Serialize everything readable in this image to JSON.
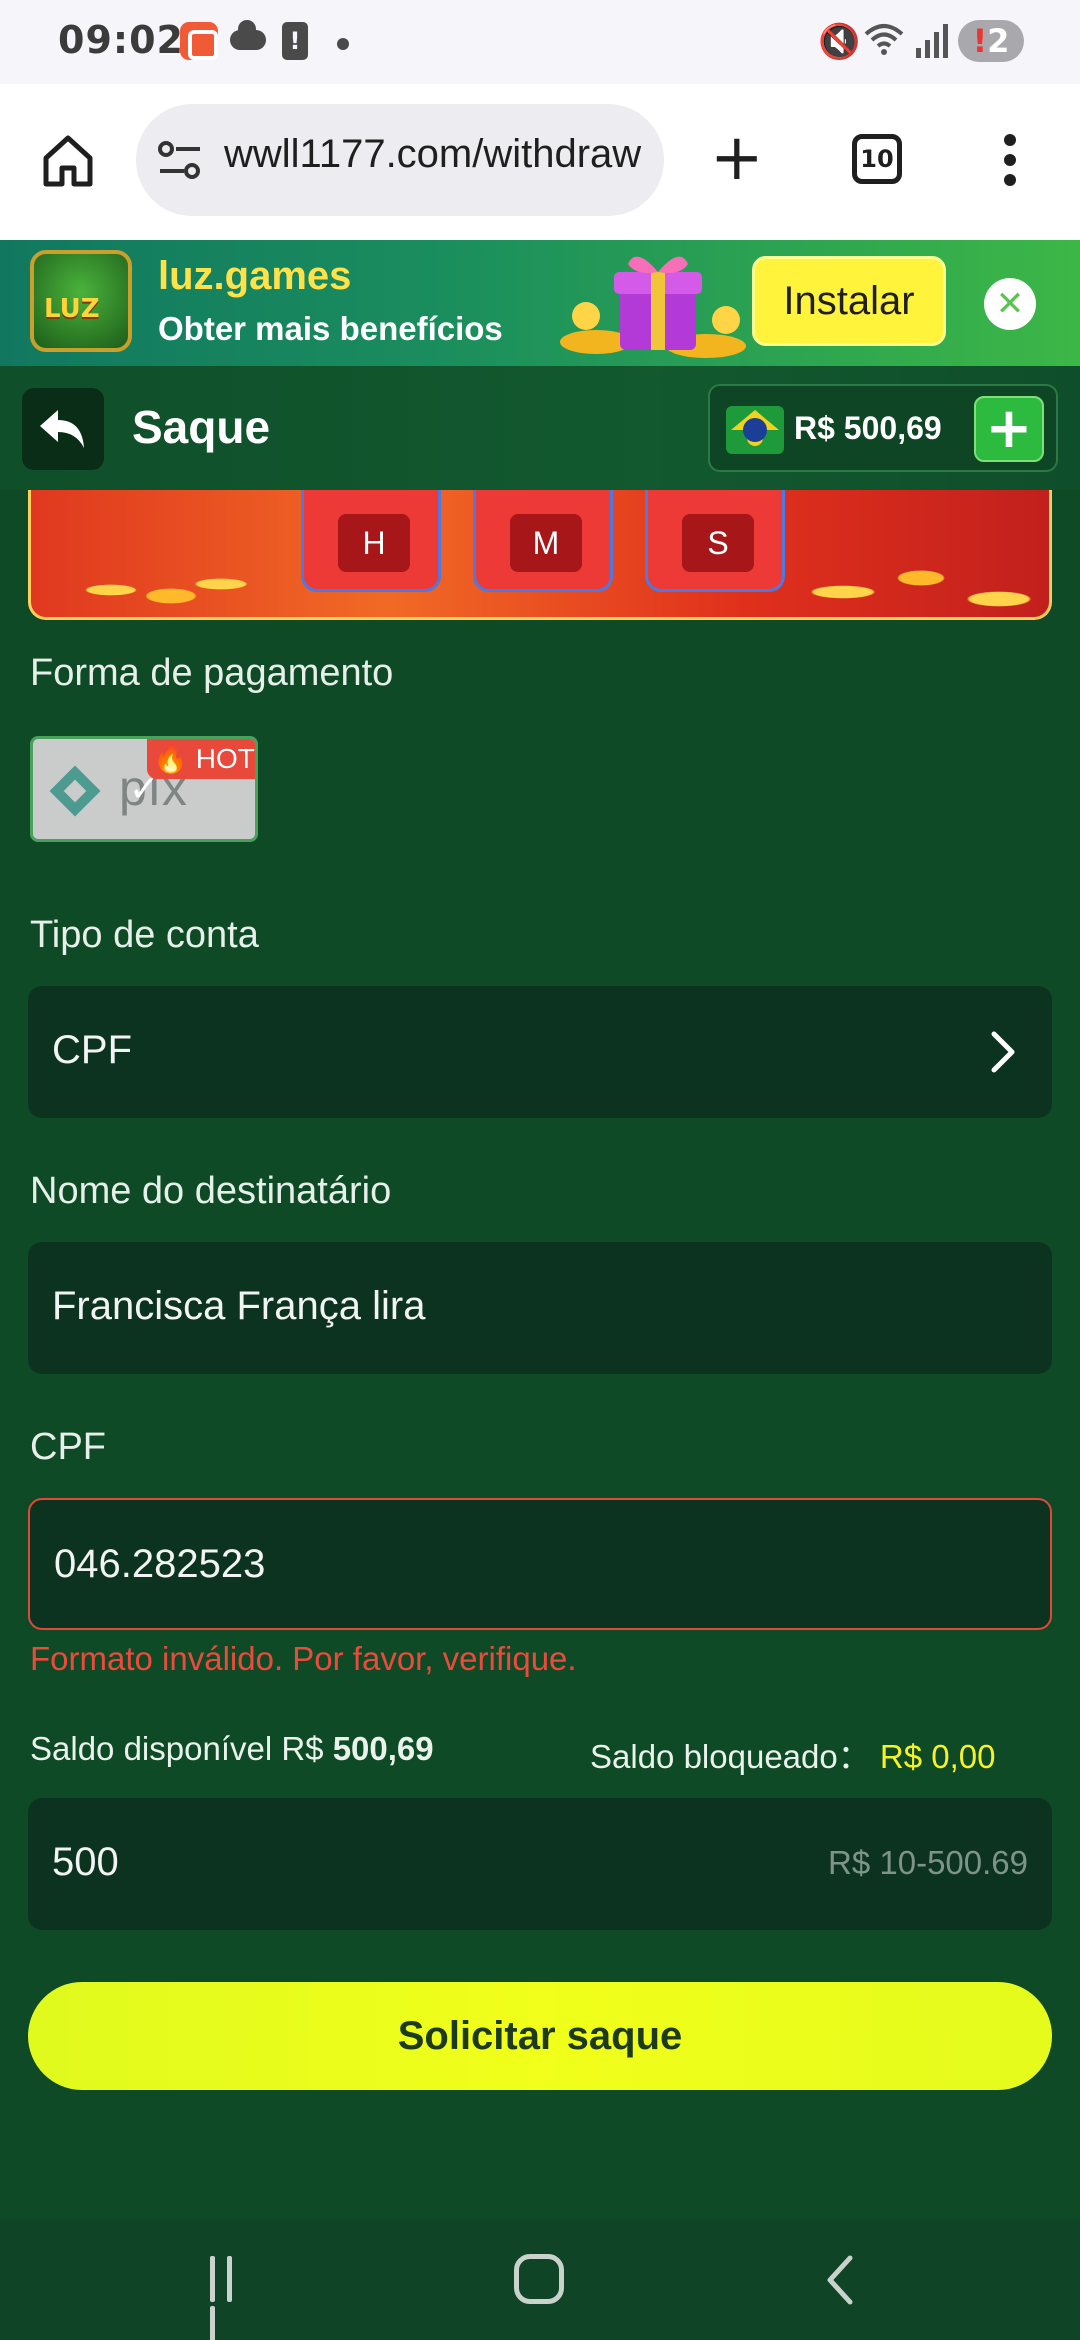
{
  "status_bar": {
    "time": "09:02",
    "notification_count": "2"
  },
  "browser": {
    "url": "wwll1177.com/withdraw",
    "tab_count": "10"
  },
  "install_banner": {
    "app_name": "luz.games",
    "subtitle": "Obter mais benefícios",
    "install_label": "Instalar",
    "logo_text": "LUZ"
  },
  "header": {
    "title": "Saque",
    "balance": "R$ 500,69"
  },
  "promo": {
    "timer_labels": [
      "H",
      "M",
      "S"
    ]
  },
  "form": {
    "payment_label": "Forma de pagamento",
    "payment_method": "pix",
    "hot_badge": "HOT",
    "account_type_label": "Tipo de conta",
    "account_type_value": "CPF",
    "recipient_label": "Nome do destinatário",
    "recipient_value": "Francisca França lira",
    "cpf_label": "CPF",
    "cpf_value": "046.282523",
    "cpf_error": "Formato inválido. Por favor, verifique.",
    "available_label": "Saldo disponível R$",
    "available_value": "500,69",
    "blocked_label": "Saldo bloqueado：",
    "blocked_value": "R$ 0,00",
    "amount_value": "500",
    "amount_placeholder": "R$ 10-500.69",
    "submit_label": "Solicitar saque"
  },
  "colors": {
    "background": "#0f4a26",
    "accent_yellow": "#f1ff1a",
    "error": "#ea4b3c",
    "field_bg": "#0c3220"
  },
  "icons": [
    "home-icon",
    "tune-icon",
    "plus-icon",
    "tabs-icon",
    "more-vert-icon",
    "close-icon",
    "back-arrow-icon",
    "add-icon",
    "brazil-flag-icon",
    "pix-icon",
    "fire-icon",
    "check-icon",
    "chevron-right-icon"
  ]
}
